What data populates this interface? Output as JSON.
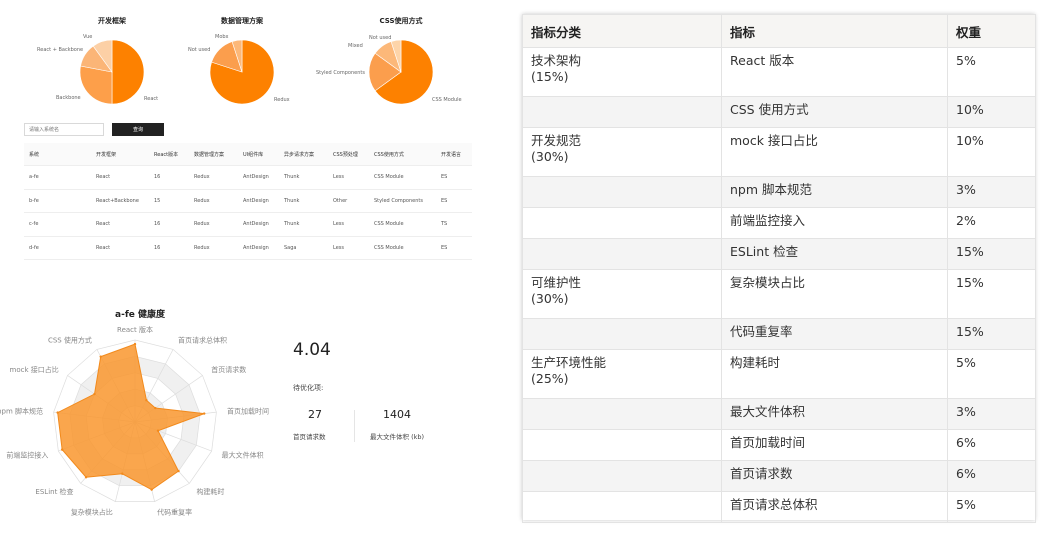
{
  "pies": [
    {
      "title": "开发框架",
      "labels": [
        "Vue",
        "React + Backbone",
        "Backbone",
        "React"
      ],
      "colors": [
        "#fcd0a6",
        "#fbb577",
        "#fd9f4a",
        "#fd8100"
      ],
      "chart_data": {
        "type": "pie",
        "title": "开发框架",
        "categories": [
          "Vue",
          "React + Backbone",
          "Backbone",
          "React"
        ],
        "values": [
          0.1,
          0.12,
          0.28,
          0.5
        ]
      }
    },
    {
      "title": "数据管理方案",
      "labels": [
        "Mobx",
        "Not used",
        "Redux"
      ],
      "colors": [
        "#fcb879",
        "#fb9e4d",
        "#fd8100"
      ],
      "chart_data": {
        "type": "pie",
        "title": "数据管理方案",
        "categories": [
          "Mobx",
          "Not used",
          "Redux"
        ],
        "values": [
          0.05,
          0.15,
          0.8
        ]
      }
    },
    {
      "title": "CSS使用方式",
      "labels": [
        "Not used",
        "Mixed",
        "Styled Components",
        "CSS Module"
      ],
      "colors": [
        "#fdd4a9",
        "#fcb879",
        "#fb9e4d",
        "#fd8100"
      ],
      "chart_data": {
        "type": "pie",
        "title": "CSS使用方式",
        "categories": [
          "Not used",
          "Mixed",
          "Styled Components",
          "CSS Module"
        ],
        "values": [
          0.05,
          0.1,
          0.2,
          0.65
        ]
      }
    }
  ],
  "search": {
    "placeholder": "请输入系统名",
    "button": "查询"
  },
  "system_table": {
    "headers": [
      "系统",
      "开发框架",
      "React版本",
      "数据管理方案",
      "UI组件库",
      "异步请求方案",
      "CSS预处理",
      "CSS使用方式",
      "开发语言"
    ],
    "rows": [
      [
        "a-fe",
        "React",
        "16",
        "Redux",
        "AntDesign",
        "Thunk",
        "Less",
        "CSS Module",
        "ES"
      ],
      [
        "b-fe",
        "React+Backbone",
        "15",
        "Redux",
        "AntDesign",
        "Thunk",
        "Other",
        "Styled Components",
        "ES"
      ],
      [
        "c-fe",
        "React",
        "16",
        "Redux",
        "AntDesign",
        "Thunk",
        "Less",
        "CSS Module",
        "TS"
      ],
      [
        "d-fe",
        "React",
        "16",
        "Redux",
        "AntDesign",
        "Saga",
        "Less",
        "CSS Module",
        "ES"
      ]
    ]
  },
  "radar": {
    "title": "a-fe 健康度",
    "chart_data": {
      "type": "radar",
      "title": "a-fe 健康度",
      "categories": [
        "React 版本",
        "首页请求总体积",
        "首页请求数",
        "首页加载时间",
        "最大文件体积",
        "构建耗时",
        "代码重复率",
        "复杂模块占比",
        "ESLint 检查",
        "前端监控接入",
        "npm 脚本规范",
        "mock 接口占比",
        "CSS 使用方式"
      ],
      "values": [
        0.95,
        0.3,
        0.3,
        0.85,
        0.3,
        0.8,
        0.85,
        0.65,
        0.9,
        0.95,
        0.95,
        0.6,
        0.9
      ],
      "range": [
        0,
        1
      ],
      "series_color": "#f9962e"
    }
  },
  "summary": {
    "score": "4.04",
    "pending_label": "待优化项:",
    "stats": [
      {
        "value": "27",
        "label": "首页请求数"
      },
      {
        "value": "1404",
        "label": "最大文件体积 (kb)"
      }
    ]
  },
  "weight_table": {
    "headers": [
      "指标分类",
      "指标",
      "权重"
    ],
    "rows": [
      {
        "category": "技术架构\n(15%)",
        "metric": "React 版本",
        "weight": "5%"
      },
      {
        "category": "",
        "metric": "CSS 使用方式",
        "weight": "10%"
      },
      {
        "category": "开发规范\n(30%)",
        "metric": "mock 接口占比",
        "weight": "10%"
      },
      {
        "category": "",
        "metric": "npm 脚本规范",
        "weight": "3%"
      },
      {
        "category": "",
        "metric": "前端监控接入",
        "weight": "2%"
      },
      {
        "category": "",
        "metric": "ESLint 检查",
        "weight": "15%"
      },
      {
        "category": "可维护性\n(30%)",
        "metric": "复杂模块占比",
        "weight": "15%"
      },
      {
        "category": "",
        "metric": "代码重复率",
        "weight": "15%"
      },
      {
        "category": "生产环境性能\n(25%)",
        "metric": "构建耗时",
        "weight": "5%"
      },
      {
        "category": "",
        "metric": "最大文件体积",
        "weight": "3%"
      },
      {
        "category": "",
        "metric": "首页加载时间",
        "weight": "6%"
      },
      {
        "category": "",
        "metric": "首页请求数",
        "weight": "6%"
      },
      {
        "category": "",
        "metric": "首页请求总体积",
        "weight": "5%"
      }
    ]
  }
}
